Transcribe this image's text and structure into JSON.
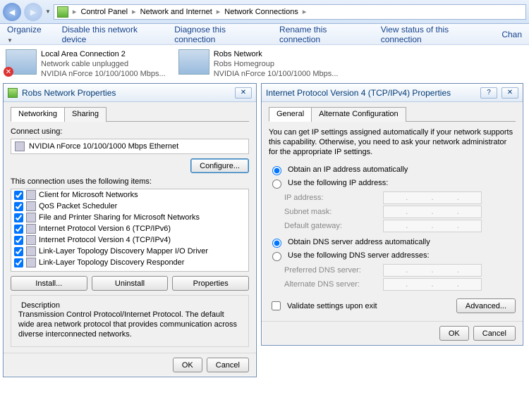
{
  "breadcrumb": {
    "a": "Control Panel",
    "b": "Network and Internet",
    "c": "Network Connections"
  },
  "toolbar": {
    "organize": "Organize",
    "disable": "Disable this network device",
    "diagnose": "Diagnose this connection",
    "rename": "Rename this connection",
    "viewstatus": "View status of this connection",
    "change": "Chan"
  },
  "nets": {
    "lac": {
      "title": "Local Area Connection 2",
      "sub1": "Network cable unplugged",
      "sub2": "NVIDIA nForce 10/100/1000 Mbps..."
    },
    "rob": {
      "title": "Robs Network",
      "sub1": "Robs Homegroup",
      "sub2": "NVIDIA nForce 10/100/1000 Mbps..."
    }
  },
  "dlg1": {
    "title": "Robs Network Properties",
    "tab1": "Networking",
    "tab2": "Sharing",
    "connect_using": "Connect using:",
    "adapter": "NVIDIA nForce 10/100/1000 Mbps Ethernet",
    "configure": "Configure...",
    "uses": "This connection uses the following items:",
    "items": [
      "Client for Microsoft Networks",
      "QoS Packet Scheduler",
      "File and Printer Sharing for Microsoft Networks",
      "Internet Protocol Version 6 (TCP/IPv6)",
      "Internet Protocol Version 4 (TCP/IPv4)",
      "Link-Layer Topology Discovery Mapper I/O Driver",
      "Link-Layer Topology Discovery Responder"
    ],
    "install": "Install...",
    "uninstall": "Uninstall",
    "properties": "Properties",
    "desc_label": "Description",
    "desc": "Transmission Control Protocol/Internet Protocol. The default wide area network protocol that provides communication across diverse interconnected networks.",
    "ok": "OK",
    "cancel": "Cancel"
  },
  "dlg2": {
    "title": "Internet Protocol Version 4 (TCP/IPv4) Properties",
    "tab1": "General",
    "tab2": "Alternate Configuration",
    "note": "You can get IP settings assigned automatically if your network supports this capability. Otherwise, you need to ask your network administrator for the appropriate IP settings.",
    "r1": "Obtain an IP address automatically",
    "r2": "Use the following IP address:",
    "ip": "IP address:",
    "subnet": "Subnet mask:",
    "gateway": "Default gateway:",
    "r3": "Obtain DNS server address automatically",
    "r4": "Use the following DNS server addresses:",
    "pdns": "Preferred DNS server:",
    "adns": "Alternate DNS server:",
    "validate": "Validate settings upon exit",
    "advanced": "Advanced...",
    "ok": "OK",
    "cancel": "Cancel"
  }
}
